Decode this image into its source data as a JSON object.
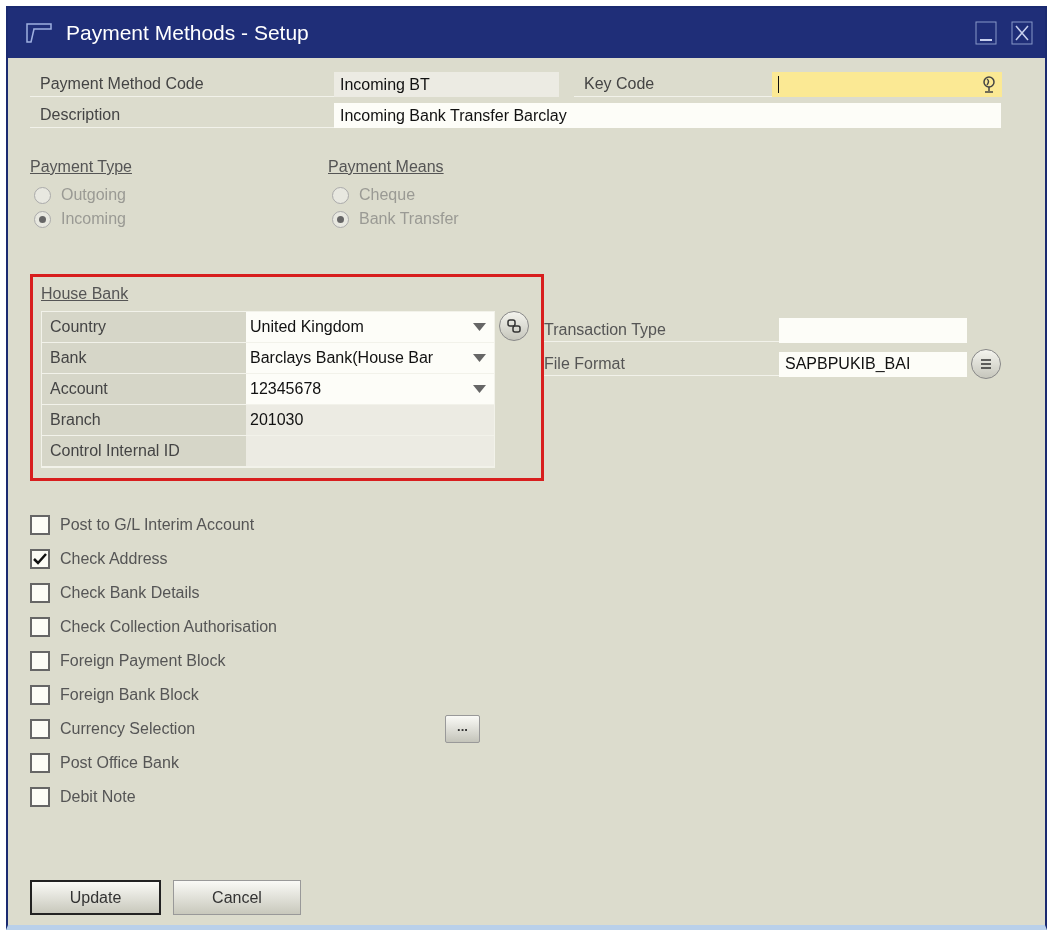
{
  "window": {
    "title": "Payment Methods - Setup"
  },
  "header_fields": [
    {
      "label": "Payment Method Code",
      "value": "Incoming BT",
      "kind": "readonly"
    },
    {
      "label": "Key Code",
      "kind": "key",
      "focused": true
    },
    {
      "label": "Description",
      "value": "Incoming Bank Transfer Barclay",
      "kind": "text"
    }
  ],
  "radio_groups": [
    {
      "title": "Payment Type",
      "options": [
        {
          "label": "Outgoing",
          "selected": false,
          "disabled": true
        },
        {
          "label": "Incoming",
          "selected": true,
          "disabled": true
        }
      ]
    },
    {
      "title": "Payment Means",
      "options": [
        {
          "label": "Cheque",
          "selected": false,
          "disabled": true
        },
        {
          "label": "Bank Transfer",
          "selected": true,
          "disabled": true
        }
      ]
    }
  ],
  "house_bank": {
    "title": "House Bank",
    "highlighted": true,
    "rows": [
      {
        "label": "Country",
        "value": "United Kingdom",
        "kind": "dropdown"
      },
      {
        "label": "Bank",
        "value": "Barclays Bank(House Bar",
        "kind": "dropdown"
      },
      {
        "label": "Account",
        "value": "12345678",
        "kind": "dropdown"
      },
      {
        "label": "Branch",
        "value": "201030",
        "kind": "readonly"
      },
      {
        "label": "Control Internal ID",
        "kind": "readonly"
      }
    ]
  },
  "side_fields": [
    {
      "label": "Transaction Type"
    },
    {
      "label": "File Format",
      "value": "SAPBPUKIB_BAI"
    }
  ],
  "checkboxes": [
    {
      "label": "Post to G/L Interim Account",
      "checked": false
    },
    {
      "label": "Check Address",
      "checked": true
    },
    {
      "label": "Check Bank Details",
      "checked": false
    },
    {
      "label": "Check Collection Authorisation",
      "checked": false
    },
    {
      "label": "Foreign Payment Block",
      "checked": false
    },
    {
      "label": "Foreign Bank Block",
      "checked": false
    },
    {
      "label": "Currency Selection",
      "checked": false,
      "button": "..."
    },
    {
      "label": "Post Office Bank",
      "checked": false
    },
    {
      "label": "Debit Note",
      "checked": false
    }
  ],
  "buttons": [
    {
      "label": "Update",
      "default": true
    },
    {
      "label": "Cancel",
      "default": false
    }
  ]
}
